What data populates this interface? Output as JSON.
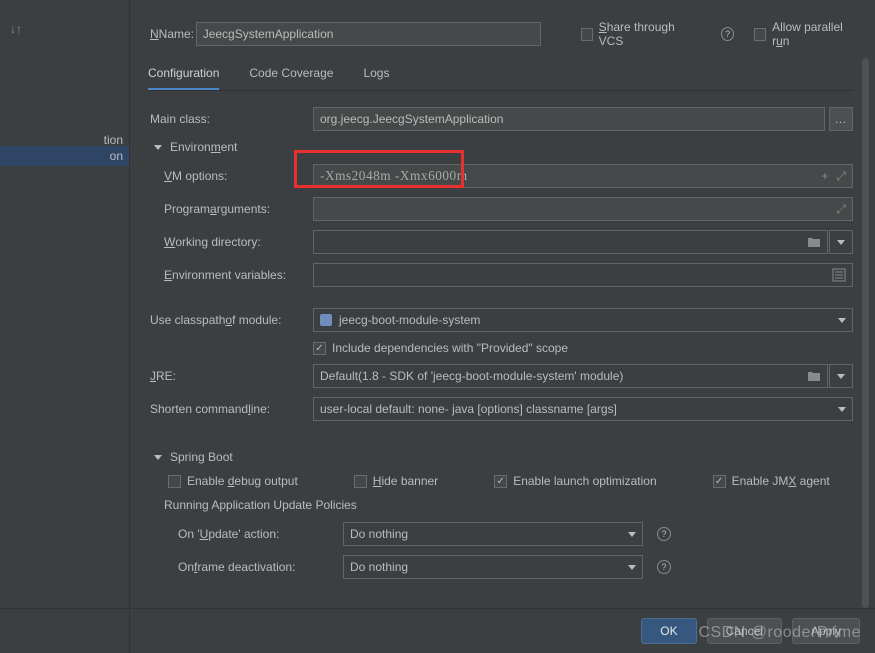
{
  "top": {
    "name_label": "Name:",
    "name_label_u": "N",
    "name_value": "JeecgSystemApplication",
    "share_label": "hare through VCS",
    "share_u": "S",
    "parallel_label": "Allow parallel run",
    "parallel_u": "u"
  },
  "tabs": {
    "t1": "Configuration",
    "t2": "Code Coverage",
    "t3": "Logs"
  },
  "fields": {
    "main_class_label": "Main class:",
    "main_class_value": "org.jeecg.JeecgSystemApplication",
    "env_label": "Environment",
    "env_u": "m",
    "vm_label": "M options:",
    "vm_u": "V",
    "vm_value": "-Xms2048m -Xmx6000m",
    "prog_args_label": "Program arguments:",
    "prog_args_u": "a",
    "workdir_label": "orking directory:",
    "workdir_u": "W",
    "envvar_label": "nvironment variables:",
    "envvar_u": "E",
    "classpath_label": "Use classpath of module:",
    "classpath_u": "o",
    "classpath_value": "jeecg-boot-module-system",
    "include_deps": "Include dependencies with \"Provided\" scope",
    "jre_label": "RE:",
    "jre_u": "J",
    "jre_value": "Default",
    "jre_hint": " (1.8 - SDK of 'jeecg-boot-module-system' module)",
    "shorten_label": "Shorten command line:",
    "shorten_u": "l",
    "shorten_value": "user-local default: none",
    "shorten_hint": " - java [options] classname [args]"
  },
  "spring": {
    "title": "Spring Boot",
    "debug": "Enable debug output",
    "debug_u": "d",
    "hide": "ide banner",
    "hide_u": "H",
    "launch": "Enable launch optimization",
    "jmx": "Enable JMX agent",
    "jmx_u": "X",
    "policies": "Running Application Update Policies",
    "on_update": "On 'Update' action:",
    "on_update_u": "U",
    "on_update_val": "Do nothing",
    "on_frame": "On frame deactivation:",
    "on_frame_u": "f",
    "on_frame_val": "Do nothing"
  },
  "tree": {
    "item1": "tion",
    "item2": "on"
  },
  "footer": {
    "ok": "OK",
    "cancel": "Cancel",
    "apply": "Apply"
  },
  "watermark": "CSDN @rooderPrime"
}
